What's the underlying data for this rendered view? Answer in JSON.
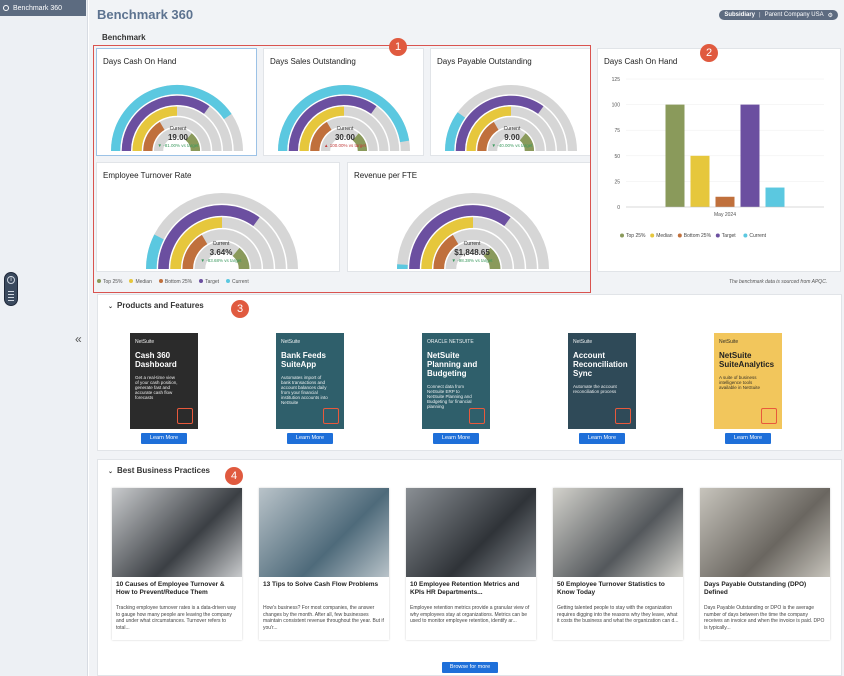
{
  "sidebar": {
    "active_item": "Benchmark 360"
  },
  "header": {
    "title": "Benchmark 360",
    "subsidiary_label": "Subsidiary",
    "subsidiary_value": "Parent Company USA"
  },
  "benchmark": {
    "section_label": "Benchmark",
    "gauges": [
      {
        "title": "Days Cash On Hand",
        "current_label": "Current",
        "current_value": "19.00",
        "delta": "-81.00% vs target",
        "direction": "down",
        "current_pct": 0.81
      },
      {
        "title": "Days Sales Outstanding",
        "current_label": "Current",
        "current_value": "30.00",
        "delta": "100.00% vs target",
        "direction": "up",
        "current_pct": 0.95
      },
      {
        "title": "Days Payable Outstanding",
        "current_label": "Current",
        "current_value": "9.00",
        "delta": "-40.00% vs target",
        "direction": "down",
        "current_pct": 0.2
      },
      {
        "title": "Employee Turnover Rate",
        "current_label": "Current",
        "current_value": "3.64%",
        "delta": "-83.68% vs target",
        "direction": "down",
        "current_pct": 0.15
      },
      {
        "title": "Revenue per FTE",
        "current_label": "Current",
        "current_value": "$1,848.65",
        "delta": "-98.38% vs target",
        "direction": "down",
        "current_pct": 0.02
      }
    ],
    "legend": [
      {
        "label": "Top 25%",
        "color": "#8a9a5b"
      },
      {
        "label": "Median",
        "color": "#e6c73c"
      },
      {
        "label": "Bottom 25%",
        "color": "#c0703c"
      },
      {
        "label": "Target",
        "color": "#6b4fa0"
      },
      {
        "label": "Current",
        "color": "#5bc8e0"
      }
    ],
    "note": "The benchmark data is sourced from APQC.",
    "badges": [
      "1",
      "2",
      "3",
      "4"
    ]
  },
  "chart_data": {
    "type": "bar",
    "title": "Days Cash On Hand",
    "categories": [
      "May 2024"
    ],
    "series": [
      {
        "name": "Top 25%",
        "values": [
          100
        ],
        "color": "#8a9a5b"
      },
      {
        "name": "Median",
        "values": [
          50
        ],
        "color": "#e6c73c"
      },
      {
        "name": "Bottom 25%",
        "values": [
          10
        ],
        "color": "#c0703c"
      },
      {
        "name": "Target",
        "values": [
          100
        ],
        "color": "#6b4fa0"
      },
      {
        "name": "Current",
        "values": [
          19
        ],
        "color": "#5bc8e0"
      }
    ],
    "yticks": [
      "125",
      "100",
      "75",
      "50",
      "25",
      "0"
    ],
    "ylim": [
      0,
      125
    ],
    "legend_position": "bottom"
  },
  "products": {
    "section_title": "Products and Features",
    "items": [
      {
        "brand": "NetSuite",
        "title": "Cash 360 Dashboard",
        "desc": "Get a real-time view of your cash position, generate fast and accurate cash flow forecasts",
        "bg": "#2b2b2b",
        "button": "Learn More"
      },
      {
        "brand": "NetSuite",
        "title": "Bank Feeds SuiteApp",
        "desc": "Automates import of bank transactions and account balances daily from your financial institution accounts into NetSuite",
        "bg": "#2f5f6b",
        "button": "Learn More"
      },
      {
        "brand": "ORACLE NETSUITE",
        "title": "NetSuite Planning and Budgeting",
        "desc": "Connect data from NetSuite ERP to NetSuite Planning and Budgeting for financial planning",
        "bg": "#2f5f6b",
        "button": "Learn More"
      },
      {
        "brand": "NetSuite",
        "title": "Account Reconciliation Sync",
        "desc": "Automate the account reconciliation process",
        "bg": "#2f4a58",
        "button": "Learn More"
      },
      {
        "brand": "NetSuite",
        "title": "NetSuite SuiteAnalytics",
        "desc": "A suite of business intelligence tools available in NetSuite",
        "bg": "#f2c65c",
        "button": "Learn More"
      }
    ]
  },
  "practices": {
    "section_title": "Best Business Practices",
    "browse_label": "Browse for more",
    "articles": [
      {
        "title": "10 Causes of Employee Turnover & How to Prevent/Reduce Them",
        "body": "Tracking employee turnover rates is a data-driven way to gauge how many people are leaving the company and under what circumstances. Turnover refers to total...",
        "img1": "#c9cbcd",
        "img2": "#3b3f44"
      },
      {
        "title": "13 Tips to Solve Cash Flow Problems",
        "body": "How's business? For most companies, the answer changes by the month. After all, few businesses maintain consistent revenue throughout the year. But if you'r...",
        "img1": "#b9c3c9",
        "img2": "#4e6a7a"
      },
      {
        "title": "10 Employee Retention Metrics and KPIs HR Departments...",
        "body": "Employee retention metrics provide a granular view of why employees stay at organizations. Metrics can be used to monitor employee retention, identify ar...",
        "img1": "#8a8f94",
        "img2": "#2f3338"
      },
      {
        "title": "50 Employee Turnover Statistics to Know Today",
        "body": "Getting talented people to stay with the organization requires digging into the reasons why they leave, what it costs the business and what the organization can d...",
        "img1": "#d3d2cc",
        "img2": "#54585c"
      },
      {
        "title": "Days Payable Outstanding (DPO) Defined",
        "body": "Days Payable Outstanding or DPO is the average number of days between the time the company receives an invoice and when the invoice is paid. DPO is typically...",
        "img1": "#c7c4bc",
        "img2": "#6a6660"
      }
    ]
  }
}
